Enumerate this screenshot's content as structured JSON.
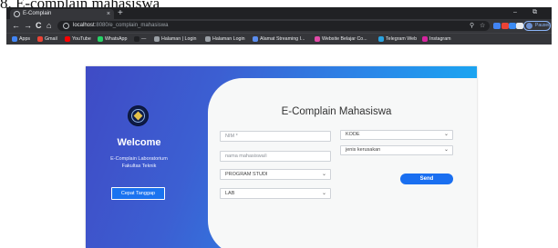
{
  "document": {
    "caption": "8.     E-complain mahasiswa"
  },
  "browser": {
    "tab_title": "E-Complain",
    "tab_close": "×",
    "new_tab": "+",
    "window_controls": {
      "minimize": "–",
      "maximize": "⧉"
    },
    "nav": {
      "back": "←",
      "forward": "→",
      "reload": "C",
      "home": "⌂"
    },
    "url": {
      "host": "localhost",
      "path": ":8080/e_complain_mahasiswa"
    },
    "omnibox_icons": {
      "search": "⚲",
      "star": "☆"
    },
    "profile_label": "Paused",
    "extension_colors": [
      "#5f6368",
      "#4285f4",
      "#ea4335",
      "#3c8bf2",
      "#e8eaed",
      "#dadce0"
    ]
  },
  "bookmarks": [
    {
      "label": "Apps",
      "color": "#4285f4"
    },
    {
      "label": "Gmail",
      "color": "#ea4335"
    },
    {
      "label": "YouTube",
      "color": "#ff0000"
    },
    {
      "label": "WhatsApp",
      "color": "#25d366"
    },
    {
      "label": "—",
      "color": "#202124"
    },
    {
      "label": "Halaman | Login",
      "color": "#9aa0a6"
    },
    {
      "label": "Halaman Login",
      "color": "#9aa0a6"
    },
    {
      "label": "Alamat Streaming I...",
      "color": "#5b8def"
    },
    {
      "label": "Website Belajar Co...",
      "color": "#e24ba8"
    },
    {
      "label": "Telegram Web",
      "color": "#2aa3e0"
    },
    {
      "label": "Instagram",
      "color": "#d6249f"
    }
  ],
  "left_panel": {
    "welcome": "Welcome",
    "line1": "E-Complain Laboratorium",
    "line2": "Fakultas Teknik",
    "quick_button": "Cepat Tanggap"
  },
  "form": {
    "title": "E-Complain Mahasiswa",
    "nim_placeholder": "NIM *",
    "nama_placeholder": "nama mahasiswa/i",
    "prodi_selected": "PROGRAM STUDI",
    "lab_selected": "LAB",
    "kode_selected": "KODE",
    "jenis_placeholder": "jenis kerusakan",
    "send_label": "Send",
    "caret": "⌄"
  },
  "colors": {
    "card_gradient": [
      "#3f4bc5",
      "#2b86e8",
      "#12b6f6"
    ],
    "accent": "#1a6ff0"
  }
}
